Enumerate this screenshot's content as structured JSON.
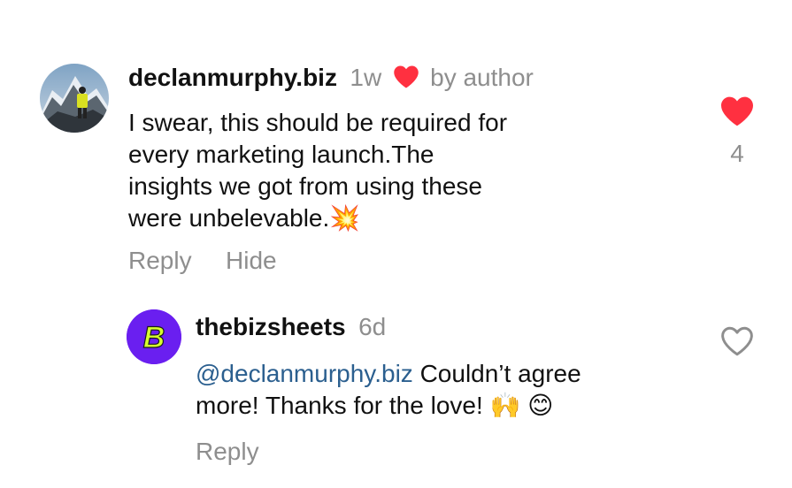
{
  "comment": {
    "username": "declanmurphy.biz",
    "time": "1w",
    "liked_by_author": "by author",
    "text": "I swear, this should be required for every marketing launch.The insights we got from using these were unbelevable.💥",
    "text_lines": [
      "I swear, this should be required for",
      "every marketing launch.The",
      "insights we got from using these",
      "were unbelevable.💥"
    ],
    "reply_label": "Reply",
    "hide_label": "Hide",
    "like_count": "4",
    "liked": true
  },
  "reply": {
    "username": "thebizsheets",
    "time": "6d",
    "mention": "@declanmurphy.biz",
    "text_line1": " Couldn’t agree",
    "text_line2": "more! Thanks for the love! 🙌 😊",
    "reply_label": "Reply",
    "avatar_letter": "B",
    "liked": false
  },
  "colors": {
    "heart_red": "#ff3040",
    "muted": "#8e8e8e",
    "mention": "#2b5f8f",
    "brand_purple": "#6a1ff0",
    "brand_yellow": "#d7ff2f"
  }
}
